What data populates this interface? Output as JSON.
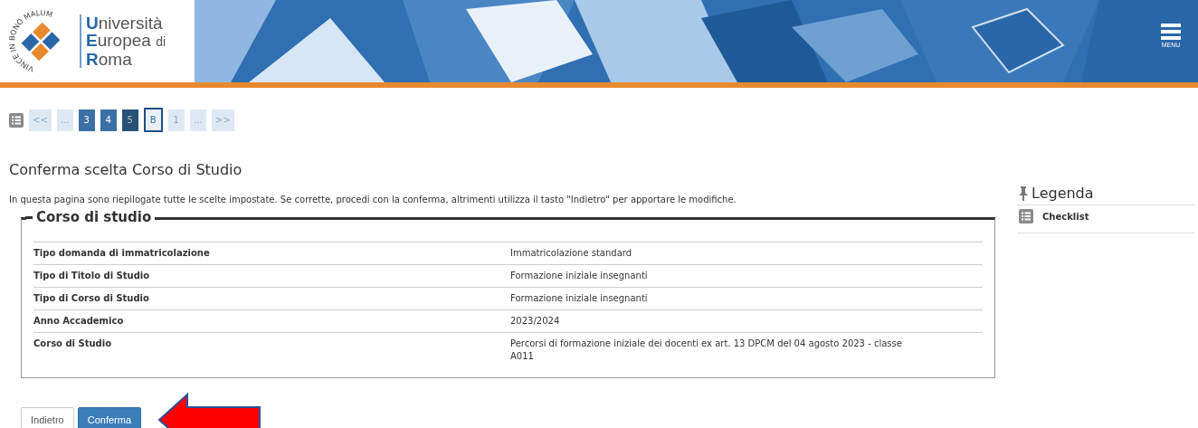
{
  "header": {
    "logo": {
      "motto": "VINCE IN BONO MALUM",
      "lines": [
        {
          "initial": "U",
          "rest": "niversità"
        },
        {
          "initial": "E",
          "rest": "uropea",
          "suffix": "di"
        },
        {
          "initial": "R",
          "rest": "oma"
        }
      ]
    },
    "menu_button": {
      "label": "MENU"
    }
  },
  "pager": [
    {
      "label": "<<",
      "completed": false,
      "selected": false,
      "focused": false
    },
    {
      "label": "...",
      "completed": false,
      "selected": false,
      "focused": false
    },
    {
      "label": "3",
      "completed": true,
      "selected": false,
      "focused": false
    },
    {
      "label": "4",
      "completed": true,
      "selected": false,
      "focused": false
    },
    {
      "label": "5",
      "completed": true,
      "selected": true,
      "focused": false
    },
    {
      "label": "B",
      "completed": false,
      "selected": false,
      "focused": true
    },
    {
      "label": "1",
      "completed": false,
      "selected": false,
      "focused": false
    },
    {
      "label": "...",
      "completed": false,
      "selected": false,
      "focused": false
    },
    {
      "label": ">>",
      "completed": false,
      "selected": false,
      "focused": false
    }
  ],
  "page_title": "Conferma scelta Corso di Studio",
  "description": "In questa pagina sono riepilogate tutte le scelte impostate. Se corrette, procedi con la conferma, altrimenti utilizza il tasto \"Indietro\" per apportare le modifiche.",
  "section": {
    "legend": "Corso di studio",
    "rows": [
      {
        "label": "Tipo domanda di immatricolazione",
        "value": "Immatricolazione standard"
      },
      {
        "label": "Tipo di Titolo di Studio",
        "value": "Formazione iniziale insegnanti"
      },
      {
        "label": "Tipo di Corso di Studio",
        "value": "Formazione iniziale insegnanti"
      },
      {
        "label": "Anno Accademico",
        "value": "2023/2024"
      },
      {
        "label": "Corso di Studio",
        "value": "Percorsi di formazione iniziale dei docenti ex art. 13 DPCM del 04 agosto 2023 - classe A011"
      }
    ]
  },
  "buttons": [
    {
      "label": "Indietro",
      "kind": "secondary"
    },
    {
      "label": "Conferma",
      "kind": "primary"
    }
  ],
  "sidebar": {
    "title": "Legenda",
    "items": [
      {
        "label": "Checklist"
      }
    ]
  }
}
